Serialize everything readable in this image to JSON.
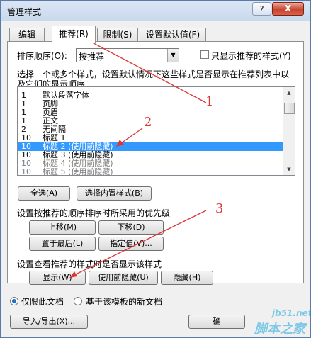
{
  "window": {
    "title": "管理样式",
    "help_glyph": "?",
    "close_glyph": "X"
  },
  "tabs": [
    "编辑",
    "推荐(R)",
    "限制(S)",
    "设置默认值(F)"
  ],
  "sort": {
    "label": "排序顺序(O):",
    "value": "按推荐",
    "only_recommended_label": "只显示推荐的样式(Y)"
  },
  "instruction": [
    "选择一个或多个样式，设置默认情况下这些样式是否显示在推荐列表中以",
    "及它们的显示顺序"
  ],
  "styles": [
    {
      "priority": "1",
      "name": "默认段落字体",
      "state": "normal"
    },
    {
      "priority": "1",
      "name": "页脚",
      "state": "normal"
    },
    {
      "priority": "1",
      "name": "页眉",
      "state": "normal"
    },
    {
      "priority": "1",
      "name": "正文",
      "state": "normal"
    },
    {
      "priority": "2",
      "name": "无间隔",
      "state": "normal"
    },
    {
      "priority": "10",
      "name": "标题 1",
      "state": "normal"
    },
    {
      "priority": "10",
      "name": "标题 2  (使用前隐藏)",
      "state": "selected"
    },
    {
      "priority": "10",
      "name": "标题 3  (使用前隐藏)",
      "state": "normal"
    },
    {
      "priority": "10",
      "name": "标题 4  (使用前隐藏)",
      "state": "gray"
    },
    {
      "priority": "10",
      "name": "标题 5  (使用前隐藏)",
      "state": "gray"
    }
  ],
  "select_buttons": {
    "select_all": "全选(A)",
    "select_builtin": "选择内置样式(B)"
  },
  "priority_section": {
    "label": "设置按推荐的顺序排序时所采用的优先级",
    "move_up": "上移(M)",
    "move_down": "下移(D)",
    "move_last": "置于最后(L)",
    "assign_value": "指定值(V)..."
  },
  "visibility_section": {
    "label": "设置查看推荐的样式时是否显示该样式",
    "show": "显示(W)",
    "hide_until_used": "使用前隐藏(U)",
    "hide": "隐藏(H)"
  },
  "scope": {
    "this_doc": "仅限此文档",
    "new_docs": "基于该模板的新文档"
  },
  "bottom": {
    "import_export": "导入/导出(X)...",
    "ok": "确"
  },
  "annotations": [
    "1",
    "2",
    "3"
  ],
  "watermark": {
    "site": "jb51.net",
    "brand": "脚本之家"
  },
  "colors": {
    "selection": "#3399ff",
    "annotation": "#e03434",
    "title_bar": "#c9d9ee"
  }
}
